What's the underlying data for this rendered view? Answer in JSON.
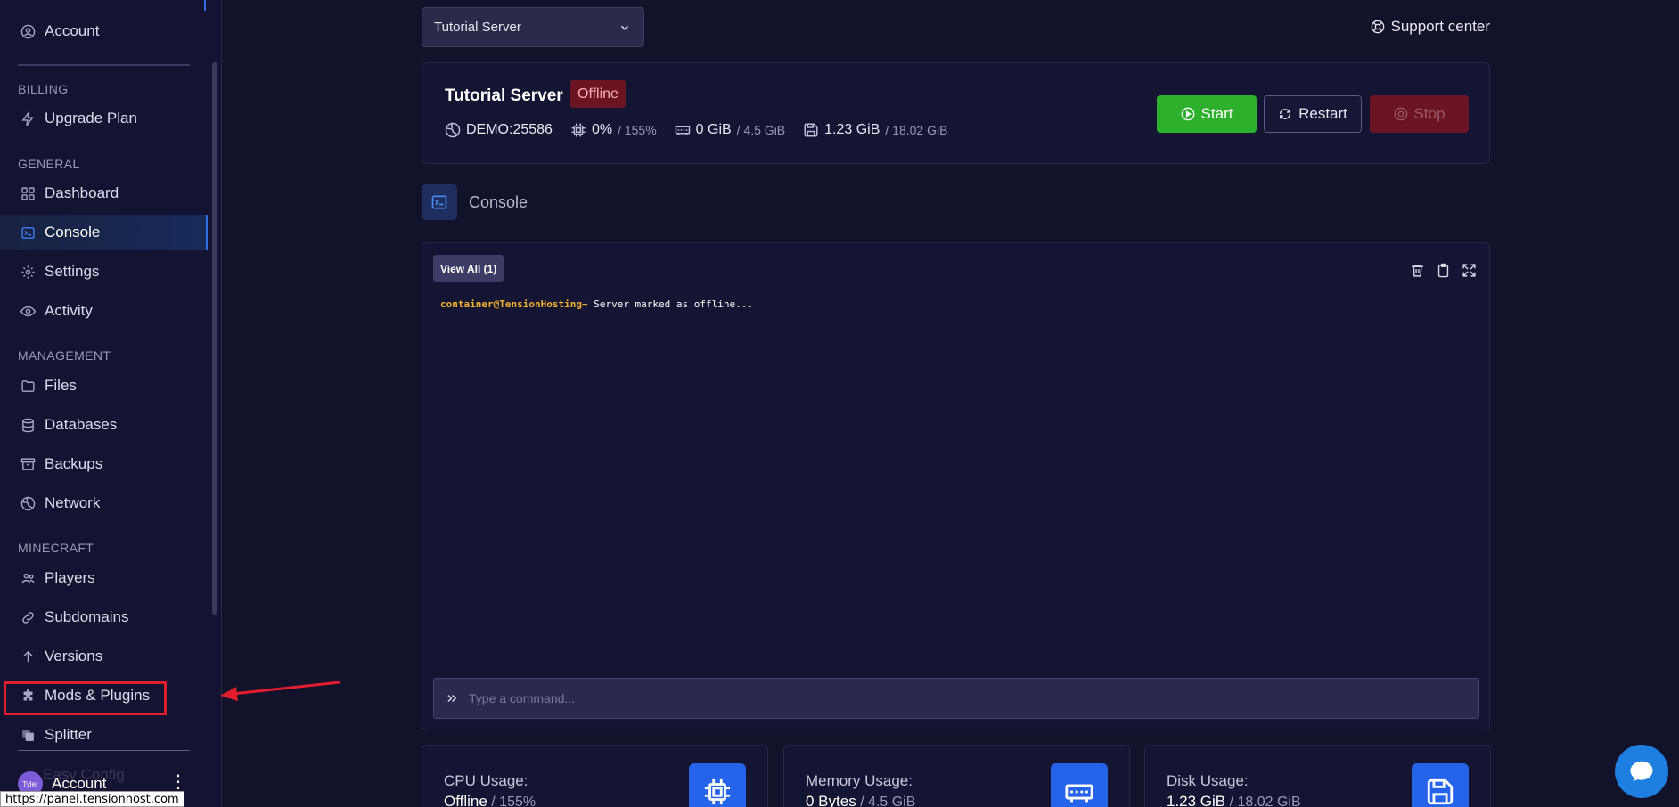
{
  "sidebar": {
    "account_top": "Account",
    "sections": {
      "billing": "BILLING",
      "general": "GENERAL",
      "management": "MANAGEMENT",
      "minecraft": "MINECRAFT"
    },
    "items": {
      "upgrade_plan": "Upgrade Plan",
      "dashboard": "Dashboard",
      "console": "Console",
      "settings": "Settings",
      "activity": "Activity",
      "files": "Files",
      "databases": "Databases",
      "backups": "Backups",
      "network": "Network",
      "players": "Players",
      "subdomains": "Subdomains",
      "versions": "Versions",
      "mods_plugins": "Mods & Plugins",
      "splitter": "Splitter",
      "easy_config": "Easy Config"
    },
    "active_item": "Console",
    "user": {
      "avatar_text": "Tyler",
      "name": "Account",
      "menu_glyph": "⋮"
    },
    "status_url": "https://panel.tensionhost.com"
  },
  "topbar": {
    "server_select": "Tutorial Server",
    "support_label": "Support center"
  },
  "server": {
    "name": "Tutorial Server",
    "status": "Offline",
    "address": "DEMO:25586",
    "cpu": {
      "value": "0%",
      "limit": "/ 155%"
    },
    "memory": {
      "value": "0 GiB",
      "limit": "/ 4.5 GiB"
    },
    "disk": {
      "value": "1.23 GiB",
      "limit": "/ 18.02 GiB"
    },
    "buttons": {
      "start": "Start",
      "restart": "Restart",
      "stop": "Stop"
    }
  },
  "console": {
    "heading": "Console",
    "view_all": "View All (1)",
    "lines": [
      {
        "prompt": "container@TensionHosting~",
        "text": " Server marked as offline..."
      }
    ],
    "command_placeholder": "Type a command..."
  },
  "usage": {
    "cpu": {
      "label": "CPU Usage:",
      "value": "Offline",
      "limit": " / 155%"
    },
    "memory": {
      "label": "Memory Usage:",
      "value": "0 Bytes",
      "limit": " / 4.5 GiB"
    },
    "disk": {
      "label": "Disk Usage:",
      "value": "1.23 GiB",
      "limit": " / 18.02 GiB"
    }
  },
  "colors": {
    "background": "#12122b",
    "sidebar": "#141432",
    "accent": "#2f6fe0",
    "start_green": "#2db02b",
    "stop_red": "#6a1424",
    "offline_badge": "#6b1422",
    "highlight_red": "#e11d2e"
  }
}
